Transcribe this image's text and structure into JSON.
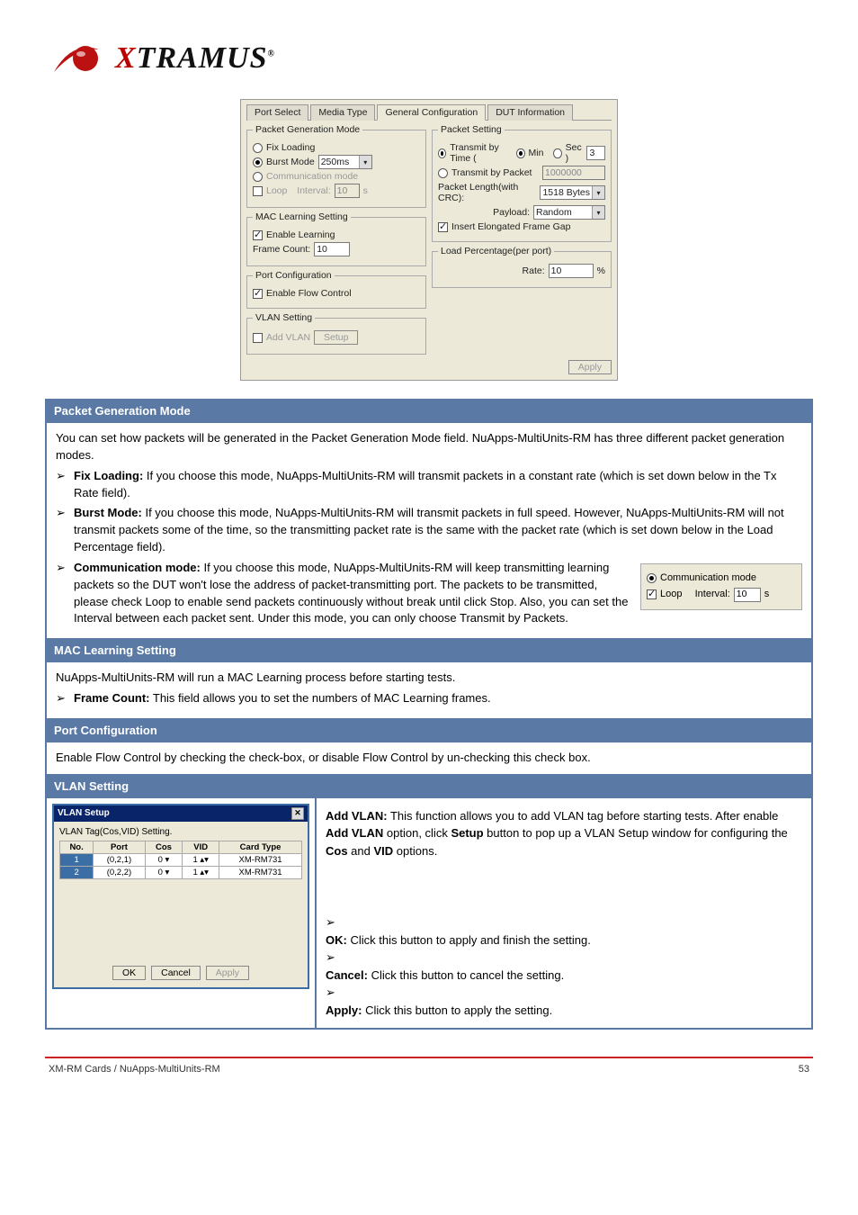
{
  "logo": {
    "brand_pre": "X",
    "brand_rest": "TRAMUS",
    "tm": "®"
  },
  "tabs": {
    "port_select": "Port Select",
    "media_type": "Media Type",
    "general_config": "General Configuration",
    "dut_info": "DUT Information"
  },
  "panel": {
    "pkt_gen_mode": {
      "legend": "Packet Generation Mode",
      "fix_loading": "Fix Loading",
      "burst_mode": "Burst Mode",
      "burst_value": "250ms",
      "comm_mode": "Communication mode",
      "loop": "Loop",
      "interval": "Interval:",
      "interval_val": "10",
      "interval_unit": "s"
    },
    "mac_learn": {
      "legend": "MAC Learning Setting",
      "enable": "Enable Learning",
      "frame_count": "Frame Count:",
      "frame_count_val": "10"
    },
    "port_conf": {
      "legend": "Port Configuration",
      "enable_flow": "Enable Flow Control"
    },
    "vlan_setting": {
      "legend": "VLAN Setting",
      "add_vlan": "Add VLAN",
      "setup": "Setup"
    },
    "pkt_setting": {
      "legend": "Packet Setting",
      "tx_time": "Transmit by Time (",
      "min": "Min",
      "sec": "Sec )",
      "tx_time_val": "3",
      "tx_packet": "Transmit by Packet",
      "tx_packet_val": "1000000",
      "pkt_len": "Packet Length(with CRC):",
      "pkt_len_val": "1518 Bytes",
      "payload": "Payload:",
      "payload_val": "Random",
      "insert_gap": "Insert Elongated Frame Gap"
    },
    "load_pct": {
      "legend": "Load Percentage(per port)",
      "rate": "Rate:",
      "rate_val": "10",
      "pct": "%"
    },
    "apply": "Apply"
  },
  "inline_panel": {
    "comm_mode": "Communication mode",
    "loop": "Loop",
    "interval": "Interval:",
    "interval_val": "10",
    "interval_unit": "s"
  },
  "sections": {
    "pkt_gen": {
      "title": "Packet Generation Mode",
      "intro": "You can set how packets will be generated in the Packet Generation Mode field. NuApps-MultiUnits-RM has three different packet generation modes.",
      "b1_strong": "Fix Loading:",
      "b1": " If you choose this mode, NuApps-MultiUnits-RM will transmit packets in a constant rate (which is set down below in the Tx Rate field).",
      "b2_strong": "Burst Mode:",
      "b2": " If you choose this mode, NuApps-MultiUnits-RM will transmit packets in full speed. However, NuApps-MultiUnits-RM will not transmit packets some of the time, so the transmitting packet rate is the same with the packet rate (which is set down below in the Load Percentage field).",
      "b3_strong": "Communication mode:",
      "b3": " If you choose this mode, NuApps-MultiUnits-RM will keep transmitting learning packets so the DUT won't lose the address of packet-transmitting port. The packets to be transmitted, please check Loop to enable send packets continuously without break until click Stop. Also, you can set the Interval between each packet sent. Under this mode, you can only choose Transmit by Packets."
    },
    "mac": {
      "title": "MAC Learning Setting",
      "intro": "NuApps-MultiUnits-RM will run a MAC Learning process before starting tests.",
      "b1_strong": "Frame Count:",
      "b1": " This field allows you to set the numbers of MAC Learning frames."
    },
    "portconf": {
      "title": "Port Configuration",
      "body": "Enable Flow Control by checking the check-box, or disable Flow Control by un-checking this check box."
    },
    "vlan": {
      "title": "VLAN Setting",
      "intro_strong": "Add VLAN:",
      "intro": " This function allows you to add VLAN tag before starting tests. After enable ",
      "intro2_strong": "Add VLAN",
      "intro2": " option, click ",
      "intro3_strong": "Setup",
      "intro3": " button to pop up a VLAN Setup window for configuring the ",
      "intro4_strong": "Cos",
      "intro4": " and ",
      "intro5_strong": "VID",
      "intro5": " options.",
      "ok_strong": "OK:",
      "ok": " Click this button to apply and finish the setting.",
      "cancel_strong": "Cancel:",
      "cancel": " Click this button to cancel the setting.",
      "apply_strong": "Apply:",
      "apply": " Click this button to apply the setting."
    }
  },
  "vlan_dialog": {
    "title": "VLAN Setup",
    "subtitle": "VLAN Tag(Cos,VID) Setting.",
    "headers": {
      "no": "No.",
      "port": "Port",
      "cos": "Cos",
      "vid": "VID",
      "card": "Card Type"
    },
    "rows": [
      {
        "no": "1",
        "port": "(0,2,1)",
        "cos": "0",
        "vid": "1",
        "card": "XM-RM731"
      },
      {
        "no": "2",
        "port": "(0,2,2)",
        "cos": "0",
        "vid": "1",
        "card": "XM-RM731"
      }
    ],
    "ok": "OK",
    "cancel": "Cancel",
    "apply": "Apply"
  },
  "footer": {
    "left": "XM-RM Cards / NuApps-MultiUnits-RM",
    "right": "53"
  }
}
